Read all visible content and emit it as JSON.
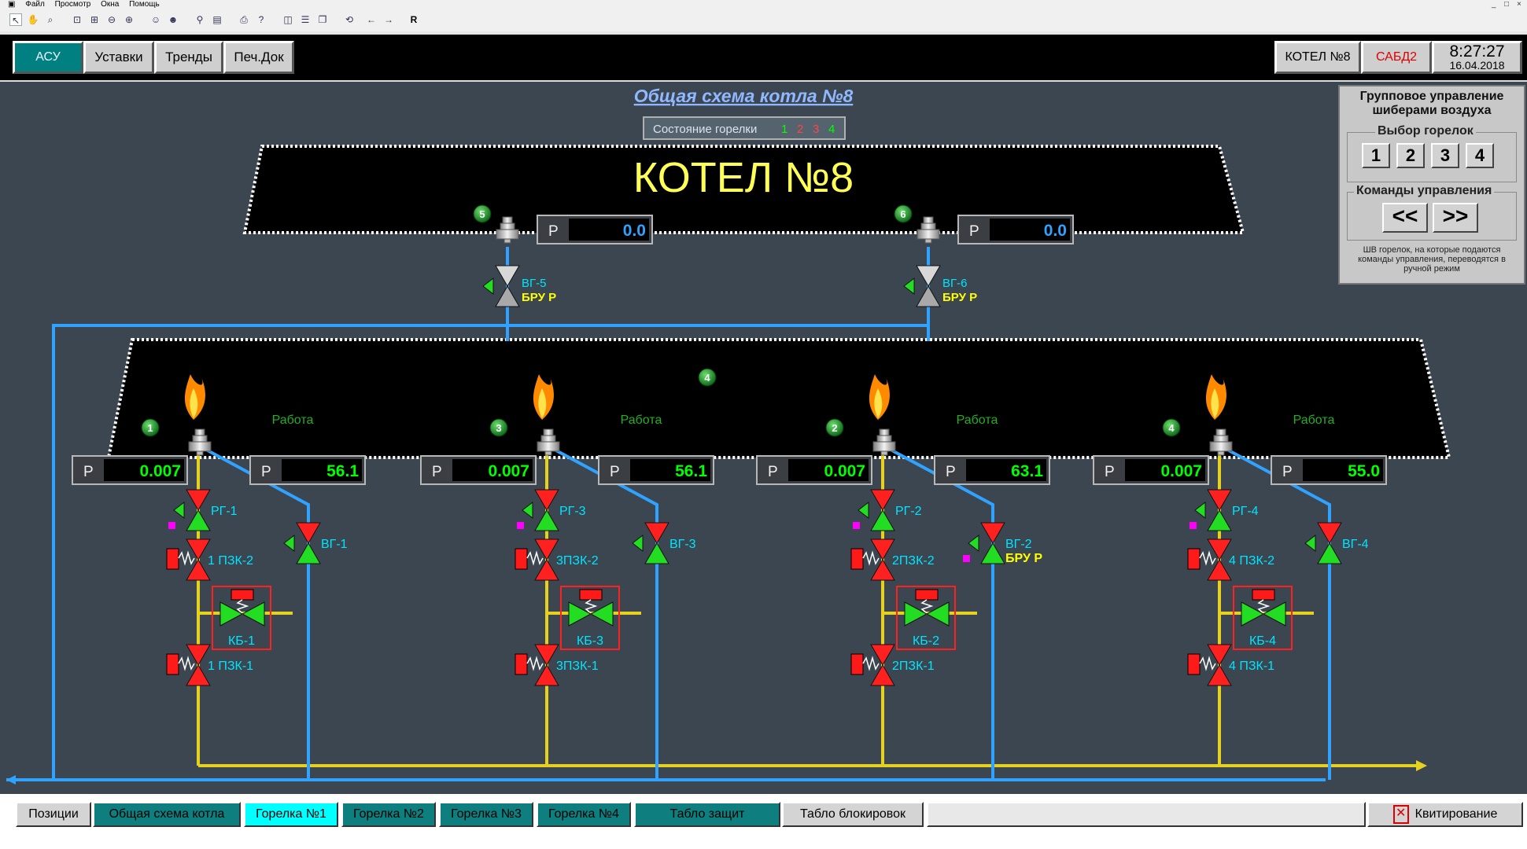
{
  "menu": [
    "Файл",
    "Просмотр",
    "Окна",
    "Помощь"
  ],
  "toolbar_letter": "R",
  "window_controls": [
    "_",
    "□",
    "×"
  ],
  "topbar": {
    "buttons": [
      {
        "label": "АСУ",
        "active": true
      },
      {
        "label": "Уставки",
        "active": false
      },
      {
        "label": "Тренды",
        "active": false
      },
      {
        "label": "Печ.Док",
        "active": false
      }
    ],
    "boiler": "КОТЕЛ №8",
    "sabd": "САБД2",
    "time": "8:27:27",
    "date": "16.04.2018"
  },
  "scheme": {
    "title": "Общая схема котла №8",
    "burner_state_label": "Состояние горелки",
    "burner_state_nums": [
      "1",
      "2",
      "3",
      "4"
    ],
    "burner_state_colors": [
      "#00ff00",
      "#ff4444",
      "#ff4444",
      "#00ff00"
    ],
    "boiler_label": "КОТЕЛ №8",
    "upper": [
      {
        "badge": "5",
        "p_label": "P",
        "p_value": "0.0",
        "valve": "ВГ-5",
        "bru": "БРУ Р"
      },
      {
        "badge": "6",
        "p_label": "P",
        "p_value": "0.0",
        "valve": "ВГ-6",
        "bru": "БРУ Р"
      }
    ],
    "furnace_badge": "4",
    "burners": [
      {
        "badge": "1",
        "status": "Работа",
        "p1_label": "P",
        "p1": "0.007",
        "p2_label": "P",
        "p2": "56.1",
        "rg": "РГ-1",
        "vg": "ВГ-1",
        "vg_sub": "",
        "pzk2": "1 ПЗК-2",
        "kb": "КБ-1",
        "pzk1": "1 ПЗК-1"
      },
      {
        "badge": "3",
        "status": "Работа",
        "p1_label": "P",
        "p1": "0.007",
        "p2_label": "P",
        "p2": "56.1",
        "rg": "РГ-3",
        "vg": "ВГ-3",
        "vg_sub": "",
        "pzk2": "3ПЗК-2",
        "kb": "КБ-3",
        "pzk1": "3ПЗК-1"
      },
      {
        "badge": "2",
        "status": "Работа",
        "p1_label": "P",
        "p1": "0.007",
        "p2_label": "P",
        "p2": "63.1",
        "rg": "РГ-2",
        "vg": "ВГ-2",
        "vg_sub": "БРУ Р",
        "pzk2": "2ПЗК-2",
        "kb": "КБ-2",
        "pzk1": "2ПЗК-1"
      },
      {
        "badge": "4",
        "status": "Работа",
        "p1_label": "P",
        "p1": "0.007",
        "p2_label": "P",
        "p2": "55.0",
        "rg": "РГ-4",
        "vg": "ВГ-4",
        "vg_sub": "",
        "pzk2": "4 ПЗК-2",
        "kb": "КБ-4",
        "pzk1": "4 ПЗК-1"
      }
    ]
  },
  "panel": {
    "title": "Групповое управление шиберами воздуха",
    "select_title": "Выбор горелок",
    "select_buttons": [
      "1",
      "2",
      "3",
      "4"
    ],
    "cmd_title": "Команды управления",
    "cmd_buttons": [
      "<<",
      ">>"
    ],
    "note": "ШВ горелок, на которые подаются команды управления, переводятся в ручной режим"
  },
  "bottom": {
    "tabs": [
      {
        "label": "Позиции",
        "style": "grey"
      },
      {
        "label": "Общая схема котла",
        "style": "teal"
      },
      {
        "label": "Горелка №1",
        "style": "cyan"
      },
      {
        "label": "Горелка №2",
        "style": "teal"
      },
      {
        "label": "Горелка №3",
        "style": "teal"
      },
      {
        "label": "Горелка №4",
        "style": "teal"
      },
      {
        "label": "Табло защит",
        "style": "teal"
      },
      {
        "label": "Табло блокировок",
        "style": "grey"
      }
    ],
    "ack": "Квитирование"
  },
  "colors": {
    "background": "#3c4651",
    "gas_pipe": "#e6d21e",
    "air_pipe": "#2fa3ff",
    "valve_open": "#22dd22",
    "valve_closed": "#ff2020",
    "value_text": "#00ff00",
    "label_text": "#00e5ff",
    "title_blue": "#8fb8ff"
  }
}
